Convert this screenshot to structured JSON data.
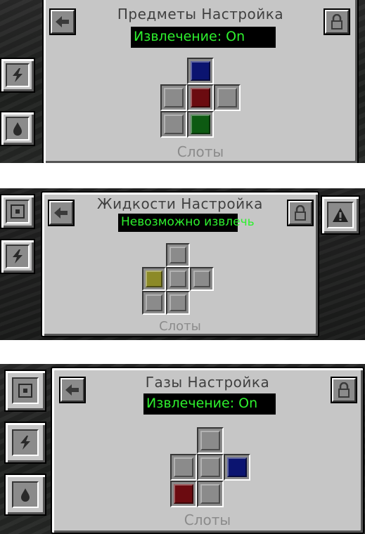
{
  "colors": {
    "panel": "#c6c6c6",
    "slot_gray": "#8b8b8b",
    "status_text": "#2ef02e",
    "blue": "#0b1470",
    "red": "#6b0b10",
    "green": "#0d5a12",
    "yellow": "#8c8a27"
  },
  "items_config": {
    "title": "Предметы Настройка",
    "status": "Извлечение: On",
    "slots_label": "Слоты",
    "side_tabs": [
      {
        "icon": "energy-icon"
      },
      {
        "icon": "fluid-drop-icon"
      }
    ],
    "back_icon": "back-arrow-icon",
    "lock_icon": "lock-icon",
    "slots": [
      {
        "position": "top",
        "color": "blue"
      },
      {
        "position": "left",
        "color": "gray"
      },
      {
        "position": "center",
        "color": "red"
      },
      {
        "position": "right",
        "color": "gray"
      },
      {
        "position": "bottom-left",
        "color": "gray"
      },
      {
        "position": "bottom",
        "color": "green"
      }
    ]
  },
  "fluids_config": {
    "title": "Жидкости Настройка",
    "status": "Невозможно извлечь",
    "slots_label": "Слоты",
    "side_tabs": [
      {
        "icon": "side-config-icon"
      },
      {
        "icon": "energy-icon"
      }
    ],
    "right_tab": {
      "icon": "warning-triangle-icon"
    },
    "back_icon": "back-arrow-icon",
    "lock_icon": "lock-icon",
    "slots": [
      {
        "position": "top",
        "color": "gray"
      },
      {
        "position": "left",
        "color": "yellow"
      },
      {
        "position": "center",
        "color": "gray"
      },
      {
        "position": "right",
        "color": "gray"
      },
      {
        "position": "bottom-left",
        "color": "gray"
      },
      {
        "position": "bottom",
        "color": "gray"
      }
    ]
  },
  "gases_config": {
    "title": "Газы Настройка",
    "status": "Извлечение: On",
    "slots_label": "Слоты",
    "side_tabs": [
      {
        "icon": "side-config-icon"
      },
      {
        "icon": "energy-icon"
      },
      {
        "icon": "fluid-drop-icon"
      }
    ],
    "back_icon": "back-arrow-icon",
    "lock_icon": "lock-icon",
    "slots": [
      {
        "position": "top",
        "color": "gray"
      },
      {
        "position": "left",
        "color": "gray"
      },
      {
        "position": "center",
        "color": "gray"
      },
      {
        "position": "right",
        "color": "blue"
      },
      {
        "position": "bottom-left",
        "color": "red"
      },
      {
        "position": "bottom",
        "color": "gray"
      }
    ]
  }
}
